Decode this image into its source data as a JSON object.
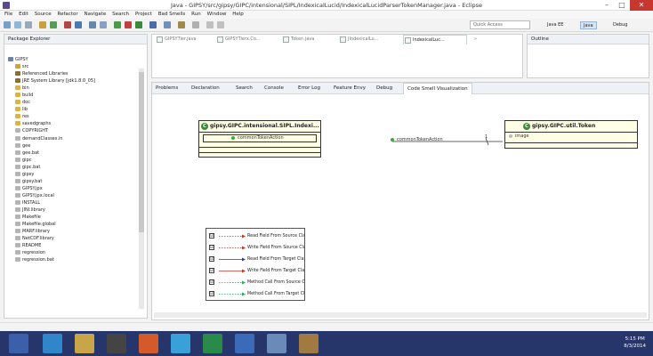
{
  "window": {
    "title": "Java - GIPSY/src/gipsy/GIPC/intensional/SIPL/IndexicalLucid/IndexicalLucidParserTokenManager.java - Eclipse",
    "min": "–",
    "max": "□",
    "close": "✕"
  },
  "menu": [
    "File",
    "Edit",
    "Source",
    "Refactor",
    "Navigate",
    "Search",
    "Project",
    "Bad Smells",
    "Run",
    "Window",
    "Help"
  ],
  "toolbar": {
    "quick_access": "Quick Access",
    "perspectives": [
      "Java EE",
      "Java",
      "Debug"
    ]
  },
  "package_explorer": {
    "title": "Package Explorer",
    "items": [
      {
        "label": "GIPSY",
        "indent": 0,
        "icon": "project-icon",
        "color": "#6d7fb1"
      },
      {
        "label": "src",
        "indent": 1,
        "icon": "source-folder-icon",
        "color": "#c8a24a"
      },
      {
        "label": "Referenced Libraries",
        "indent": 1,
        "icon": "library-icon",
        "color": "#8a6d3b"
      },
      {
        "label": "JRE System Library [jdk1.8.0_05]",
        "indent": 1,
        "icon": "library-icon",
        "color": "#8a6d3b"
      },
      {
        "label": "bin",
        "indent": 1,
        "icon": "folder-icon",
        "color": "#d9b44a"
      },
      {
        "label": "build",
        "indent": 1,
        "icon": "folder-icon",
        "color": "#d9b44a"
      },
      {
        "label": "doc",
        "indent": 1,
        "icon": "folder-icon",
        "color": "#d9b44a"
      },
      {
        "label": "lib",
        "indent": 1,
        "icon": "folder-icon",
        "color": "#d9b44a"
      },
      {
        "label": "res",
        "indent": 1,
        "icon": "folder-icon",
        "color": "#d9b44a"
      },
      {
        "label": "savedgraphs",
        "indent": 1,
        "icon": "folder-icon",
        "color": "#d9b44a"
      },
      {
        "label": "COPYRIGHT",
        "indent": 1,
        "icon": "file-icon",
        "color": "#b5b5b5"
      },
      {
        "label": "demandClasses.in",
        "indent": 1,
        "icon": "file-icon",
        "color": "#b5b5b5"
      },
      {
        "label": "gee",
        "indent": 1,
        "icon": "file-icon",
        "color": "#b5b5b5"
      },
      {
        "label": "gee.bat",
        "indent": 1,
        "icon": "file-icon",
        "color": "#b5b5b5"
      },
      {
        "label": "gipc",
        "indent": 1,
        "icon": "file-icon",
        "color": "#b5b5b5"
      },
      {
        "label": "gipc.bat",
        "indent": 1,
        "icon": "file-icon",
        "color": "#b5b5b5"
      },
      {
        "label": "gipsy",
        "indent": 1,
        "icon": "file-icon",
        "color": "#b5b5b5"
      },
      {
        "label": "gipsy.bat",
        "indent": 1,
        "icon": "file-icon",
        "color": "#b5b5b5"
      },
      {
        "label": "GIPSY.jpx",
        "indent": 1,
        "icon": "file-icon",
        "color": "#b5b5b5"
      },
      {
        "label": "GIPSY.jpx.local",
        "indent": 1,
        "icon": "file-icon",
        "color": "#b5b5b5"
      },
      {
        "label": "INSTALL",
        "indent": 1,
        "icon": "file-icon",
        "color": "#b5b5b5"
      },
      {
        "label": "JINI.library",
        "indent": 1,
        "icon": "file-icon",
        "color": "#b5b5b5"
      },
      {
        "label": "Makefile",
        "indent": 1,
        "icon": "file-icon",
        "color": "#b5b5b5"
      },
      {
        "label": "Makefile.global",
        "indent": 1,
        "icon": "file-icon",
        "color": "#b5b5b5"
      },
      {
        "label": "MARF.library",
        "indent": 1,
        "icon": "file-icon",
        "color": "#b5b5b5"
      },
      {
        "label": "NetCDF.library",
        "indent": 1,
        "icon": "file-icon",
        "color": "#b5b5b5"
      },
      {
        "label": "README",
        "indent": 1,
        "icon": "file-icon",
        "color": "#b5b5b5"
      },
      {
        "label": "regression",
        "indent": 1,
        "icon": "file-icon",
        "color": "#b5b5b5"
      },
      {
        "label": "regression.bat",
        "indent": 1,
        "icon": "file-icon",
        "color": "#b5b5b5"
      }
    ]
  },
  "editor_tabs": [
    "GIPSYTier.java",
    "GIPSYTierx.Co...",
    "Token.java",
    "JIndexicalLu...",
    "IndexicalLuc..."
  ],
  "editor_overflow": "»",
  "outline": {
    "title": "Outline"
  },
  "view_tabs": [
    "Problems",
    "Declaration",
    "Search",
    "Console",
    "Error Log",
    "Feature Envy",
    "Debug",
    "Code Smell Visualization"
  ],
  "diagram": {
    "class1": {
      "name": "gipsy.GIPC.intensional.SIPL.Indexi...",
      "method": "commonTokenAction"
    },
    "relation_label": "commonTokenAction",
    "multiplicity": "1",
    "class2": {
      "name": "gipsy.GIPC.util.Token",
      "field": "image"
    },
    "legend": [
      {
        "label": "Read Field From Source Class",
        "color": "#c0392b",
        "style": "dotted"
      },
      {
        "label": "Write Field From Source Class",
        "color": "#c0392b",
        "style": "dotted"
      },
      {
        "label": "Read Field From Target Class",
        "color": "#2b3f8c",
        "style": "solid"
      },
      {
        "label": "Write Field From Target Class",
        "color": "#c0392b",
        "style": "solid"
      },
      {
        "label": "Method Call From Source Class",
        "color": "#27ae60",
        "style": "dotted"
      },
      {
        "label": "Method Call From Target Class",
        "color": "#27ae60",
        "style": "dotted"
      }
    ],
    "checkmark": "☑"
  },
  "taskbar": {
    "time": "5:15 PM",
    "date": "8/3/2014"
  }
}
